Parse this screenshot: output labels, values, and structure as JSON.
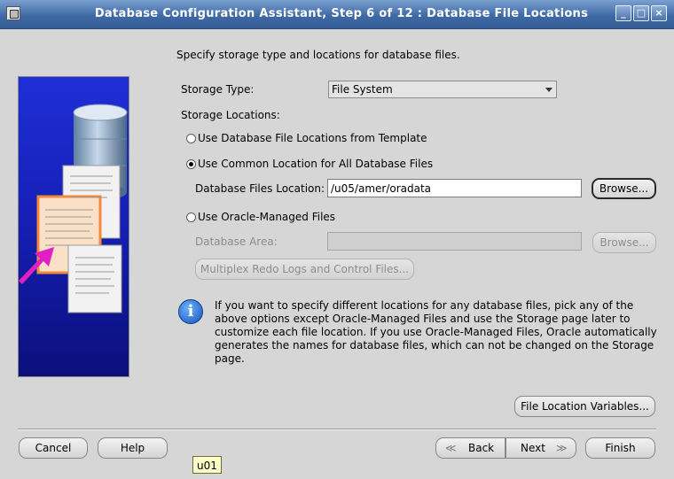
{
  "window": {
    "title": "Database Configuration Assistant, Step 6 of 12 : Database File Locations",
    "minimize_glyph": "_",
    "maximize_glyph": "□",
    "close_glyph": "×"
  },
  "intro": "Specify storage type and locations for database files.",
  "storage_type": {
    "label": "Storage Type:",
    "value": "File System"
  },
  "storage_locations_label": "Storage Locations:",
  "options": {
    "template": "Use Database File Locations from Template",
    "common": "Use Common Location for All Database Files",
    "managed": "Use Oracle-Managed Files"
  },
  "selected_option": "common",
  "db_files_location": {
    "label": "Database Files Location:",
    "value": "/u05/amer/oradata",
    "browse": "Browse..."
  },
  "database_area": {
    "label": "Database Area:",
    "value": "",
    "browse": "Browse..."
  },
  "multiplex_button": "Multiplex Redo Logs and Control Files...",
  "info": {
    "icon": "info-icon",
    "text": "If you want to specify different locations for any database files, pick any of the above options except Oracle-Managed Files and use the Storage page later to customize each file location. If you use Oracle-Managed Files, Oracle automatically generates the names for database files, which can not be changed on the Storage page."
  },
  "file_location_variables": "File Location Variables...",
  "footer": {
    "cancel": "Cancel",
    "help": "Help",
    "back": "Back",
    "next": "Next",
    "finish": "Finish"
  },
  "tooltip": "u01",
  "colors": {
    "titlebar": "#3f6aa6",
    "panel": "#d6d6d6",
    "tooltip": "#ffffc8",
    "sidebar": "#1620b8",
    "accent_arrow": "#e020c0"
  }
}
